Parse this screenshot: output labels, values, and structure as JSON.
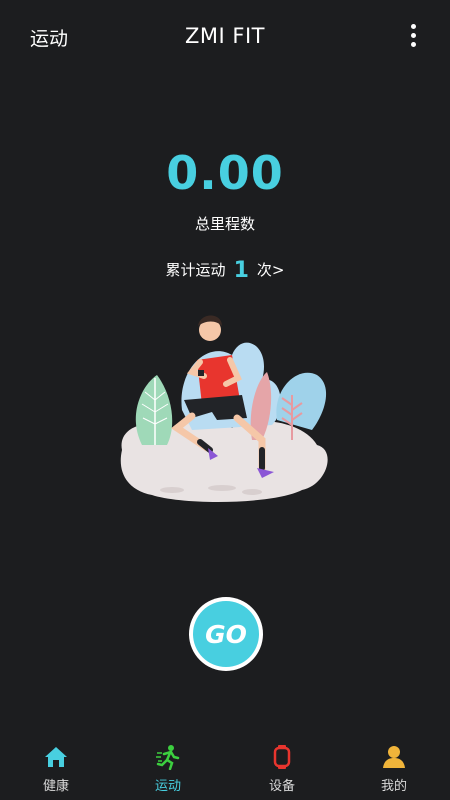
{
  "header": {
    "left_label": "运动",
    "title": "ZMI FIT"
  },
  "summary": {
    "distance": "0.00",
    "distance_label": "总里程数",
    "count_prefix": "累计运动",
    "count_value": "1",
    "count_suffix": "次>"
  },
  "go_button": {
    "label": "GO"
  },
  "tabs": [
    {
      "label": "健康",
      "icon": "house-icon",
      "active": false
    },
    {
      "label": "运动",
      "icon": "runner-icon",
      "active": true
    },
    {
      "label": "设备",
      "icon": "watch-icon",
      "active": false
    },
    {
      "label": "我的",
      "icon": "person-icon",
      "active": false
    }
  ],
  "colors": {
    "accent": "#48cfe0",
    "background": "#1c1d1f",
    "active_tab_icon": "#3ccf3f",
    "device_icon": "#e8352e",
    "profile_icon": "#f0b43a"
  }
}
